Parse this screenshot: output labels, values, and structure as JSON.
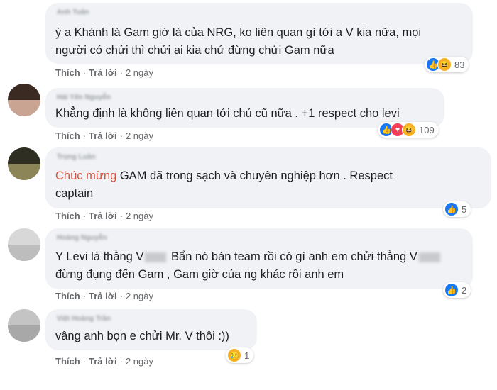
{
  "comments": [
    {
      "author": "Anh Tuấn",
      "lines": [
        "ý a Khánh là Gam giờ là của NRG, ko liên quan gì tới a V kia nữa, mọi",
        "người có chửi thì chửi ai kia chứ đừng chửi Gam nữa"
      ],
      "actions": {
        "like": "Thích",
        "reply": "Trả lời",
        "time": "2 ngày"
      },
      "reactions": {
        "icons": [
          "like",
          "haha"
        ],
        "count": "83"
      }
    },
    {
      "author": "Hải Yến Nguyễn",
      "lines": [
        "Khẳng định là không liên quan tới chủ cũ nữa . +1 respect cho levi"
      ],
      "actions": {
        "like": "Thích",
        "reply": "Trả lời",
        "time": "2 ngày"
      },
      "reactions": {
        "icons": [
          "like",
          "love",
          "haha"
        ],
        "count": "109"
      }
    },
    {
      "author": "Trọng Luân",
      "highlight": "Chúc mừng",
      "line1_rest": " GAM đã trong sạch và chuyên nghiệp hơn . Respect",
      "line2": "captain",
      "actions": {
        "like": "Thích",
        "reply": "Trả lời",
        "time": "2 ngày"
      },
      "reactions": {
        "icons": [
          "like"
        ],
        "count": "5"
      }
    },
    {
      "author": "Hoàng Nguyễn",
      "line1_a": "Y Levi là thằng V",
      "line1_b": " Bẩn nó bán team rồi có gì anh em chửi thằng V",
      "line2": "đừng đụng đến Gam , Gam giờ của ng khác rồi anh em",
      "actions": {
        "like": "Thích",
        "reply": "Trả lời",
        "time": "2 ngày"
      },
      "reactions": {
        "icons": [
          "like"
        ],
        "count": "2"
      }
    },
    {
      "author": "Việt Hoàng Trần",
      "lines": [
        "vâng anh bọn e chửi Mr. V thôi :))"
      ],
      "actions": {
        "like": "Thích",
        "reply": "Trả lời",
        "time": "2 ngày"
      },
      "reactions": {
        "icons": [
          "sad"
        ],
        "count": "1"
      }
    }
  ],
  "icon_glyphs": {
    "like": "👍",
    "love": "♥",
    "haha": "😆",
    "sad": "😢"
  },
  "colors": {
    "bubble": "#f0f2f5",
    "like": "#1877f2",
    "love": "#f33e58",
    "haha": "#f7b125",
    "highlight": "#d9553f"
  }
}
